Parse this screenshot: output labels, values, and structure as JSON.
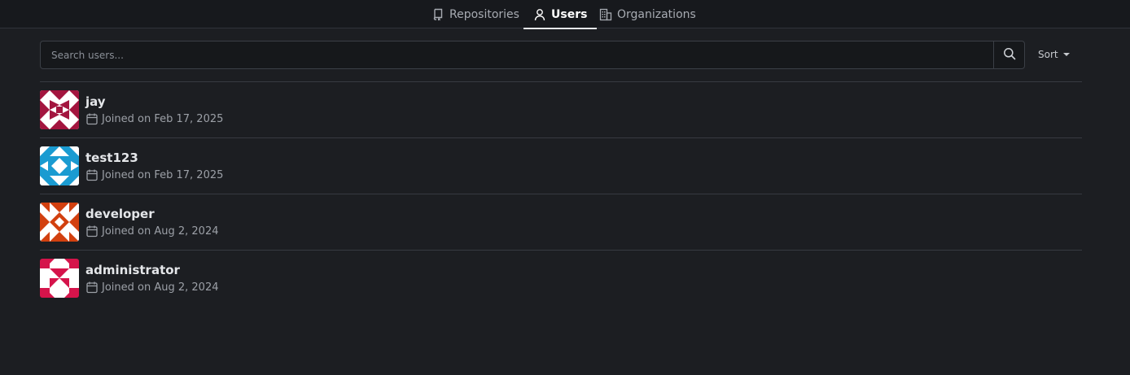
{
  "tabs": [
    {
      "label": "Repositories",
      "icon": "repo-icon",
      "active": false
    },
    {
      "label": "Users",
      "icon": "person-icon",
      "active": true
    },
    {
      "label": "Organizations",
      "icon": "organization-icon",
      "active": false
    }
  ],
  "search": {
    "placeholder": "Search users...",
    "value": "",
    "button_icon": "search-icon"
  },
  "sort": {
    "label": "Sort",
    "icon": "chevron-down-icon"
  },
  "users": [
    {
      "name": "jay",
      "joined": "Joined on Feb 17, 2025",
      "avatar_color": "#a3153f"
    },
    {
      "name": "test123",
      "joined": "Joined on Feb 17, 2025",
      "avatar_color": "#1a9bd1"
    },
    {
      "name": "developer",
      "joined": "Joined on Aug 2, 2024",
      "avatar_color": "#d2400f"
    },
    {
      "name": "administrator",
      "joined": "Joined on Aug 2, 2024",
      "avatar_color": "#d5144b"
    }
  ],
  "colors": {
    "background": "#1c1e22",
    "nav_background": "#17191d",
    "active_tab": "#ffffff",
    "border": "#373a41"
  }
}
